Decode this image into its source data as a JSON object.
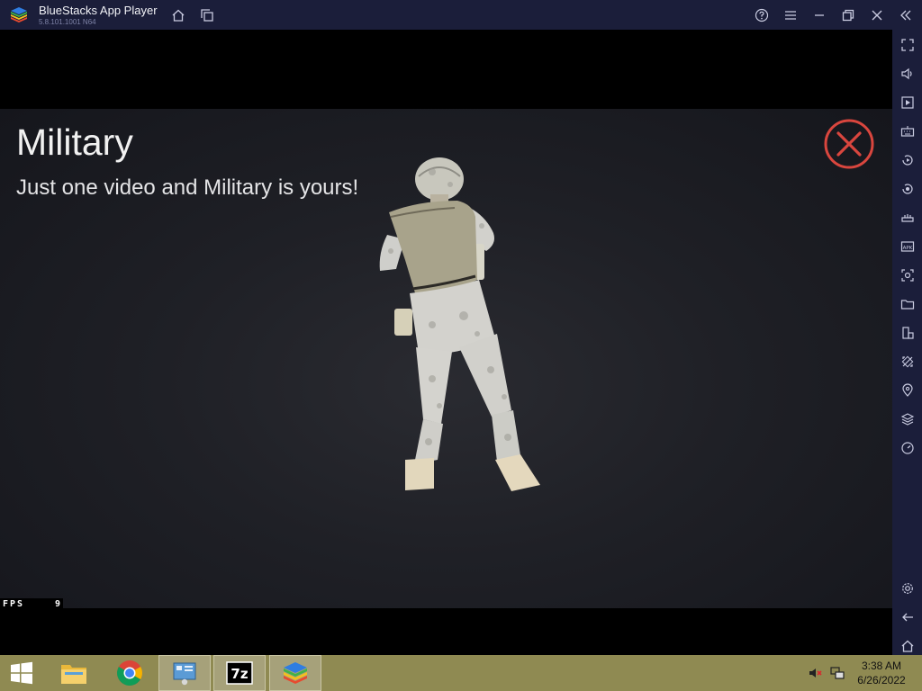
{
  "window": {
    "title": "BlueStacks App Player",
    "version": "5.8.101.1001 N64",
    "controls": [
      "home-icon",
      "multi-instance-icon",
      "help-icon",
      "menu-icon",
      "minimize-icon",
      "restore-icon",
      "close-icon",
      "collapse-sidebar-icon"
    ]
  },
  "sidebar": {
    "tools": [
      "fullscreen-icon",
      "volume-icon",
      "media-manager-icon",
      "keyboard-controls-icon",
      "macro-icon",
      "record-icon",
      "game-controls-icon",
      "install-apk-icon",
      "screenshot-icon",
      "folder-icon",
      "rotate-icon",
      "eco-mode-icon",
      "location-icon",
      "layers-icon",
      "performance-icon"
    ],
    "bottom": [
      "settings-icon",
      "back-icon",
      "android-home-icon"
    ]
  },
  "game": {
    "title": "Military",
    "subtitle": "Just one video and Military is yours!",
    "fps_label": "FPS",
    "fps_value": "9",
    "accent_color": "#d9463e"
  },
  "taskbar": {
    "apps": [
      "windows-start-icon",
      "file-explorer-icon",
      "chrome-icon",
      "control-panel-icon",
      "7zip-icon",
      "bluestacks-icon"
    ],
    "tray": [
      "volume-muted-icon",
      "network-icon"
    ],
    "clock_time": "3:38 AM",
    "clock_date": "6/26/2022"
  }
}
